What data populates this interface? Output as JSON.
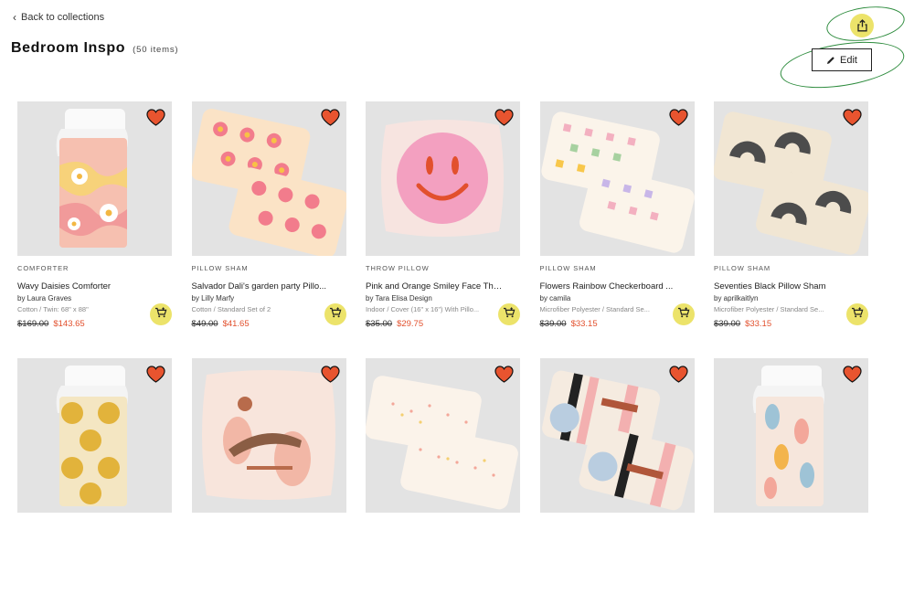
{
  "header": {
    "back_label": "Back to collections",
    "title": "Bedroom Inspo",
    "count": "(50 items)",
    "edit_label": "Edit"
  },
  "colors": {
    "accent_yellow": "#ece36a",
    "sale_red": "#e2502d",
    "heart": "#e8542f",
    "annotation_green": "#2e8c3e"
  },
  "icons": {
    "share": "share-icon",
    "edit": "pencil-icon",
    "heart": "heart-icon",
    "cart": "add-to-cart-icon"
  },
  "products": [
    {
      "category": "COMFORTER",
      "name": "Wavy Daisies Comforter",
      "by": "by Laura Graves",
      "options": "Cotton / Twin: 68\" x 88\"",
      "old_price": "$169.00",
      "sale_price": "$143.65",
      "art": "comforter-daisy"
    },
    {
      "category": "PILLOW SHAM",
      "name": "Salvador Dali's garden party Pillo...",
      "by": "by Lilly Marfy",
      "options": "Cotton / Standard Set of 2",
      "old_price": "$49.00",
      "sale_price": "$41.65",
      "art": "sham-floral"
    },
    {
      "category": "THROW PILLOW",
      "name": "Pink and Orange Smiley Face Thr...",
      "by": "by Tara Elisa Design",
      "options": "Indoor / Cover (16\" x 16\") With Pillo...",
      "old_price": "$35.00",
      "sale_price": "$29.75",
      "art": "pillow-smiley"
    },
    {
      "category": "PILLOW SHAM",
      "name": "Flowers Rainbow Checkerboard ...",
      "by": "by camila",
      "options": "Microfiber Polyester / Standard Se...",
      "old_price": "$39.00",
      "sale_price": "$33.15",
      "art": "sham-checker"
    },
    {
      "category": "PILLOW SHAM",
      "name": "Seventies Black Pillow Sham",
      "by": "by aprilkaitlyn",
      "options": "Microfiber Polyester / Standard Se...",
      "old_price": "$39.00",
      "sale_price": "$33.15",
      "art": "sham-black"
    },
    {
      "category": "",
      "name": "",
      "by": "",
      "options": "",
      "old_price": "",
      "sale_price": "",
      "art": "comforter-mustard"
    },
    {
      "category": "",
      "name": "",
      "by": "",
      "options": "",
      "old_price": "",
      "sale_price": "",
      "art": "pillow-figure"
    },
    {
      "category": "",
      "name": "",
      "by": "",
      "options": "",
      "old_price": "",
      "sale_price": "",
      "art": "sham-speckle"
    },
    {
      "category": "",
      "name": "",
      "by": "",
      "options": "",
      "old_price": "",
      "sale_price": "",
      "art": "sham-abstract"
    },
    {
      "category": "",
      "name": "",
      "by": "",
      "options": "",
      "old_price": "",
      "sale_price": "",
      "art": "comforter-leaves"
    }
  ]
}
